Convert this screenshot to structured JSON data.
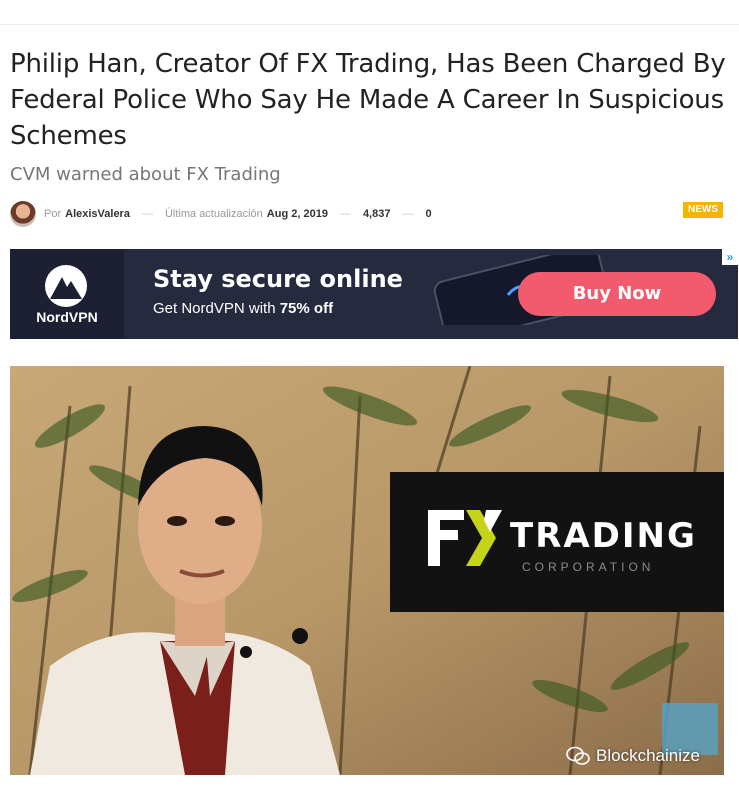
{
  "article": {
    "title": "Philip Han, Creator Of FX Trading, Has Been Charged By Federal Police Who Say He Made A Career In Suspicious Schemes",
    "subtitle": "CVM warned about FX Trading",
    "by_label": "Por",
    "author": "AlexisValera",
    "updated_label": "Última actualización",
    "date": "Aug 2, 2019",
    "views": "4,837",
    "comments": "0",
    "category_badge": "NEWS"
  },
  "ad": {
    "brand": "NordVPN",
    "headline": "Stay secure online",
    "sub_prefix": "Get NordVPN with ",
    "sub_bold": "75% off",
    "cta": "Buy Now",
    "adchoices_icon": "adchoices-icon",
    "colors": {
      "background": "#262a3f",
      "button": "#f25a6e"
    }
  },
  "hero": {
    "logo_word": "TRADING",
    "logo_sub": "CORPORATION",
    "logo_mark": "FX",
    "watermark": "Blockchainize",
    "watermark_icon": "wechat-icon"
  },
  "colors": {
    "badge": "#f5b400",
    "title": "#222222",
    "subtitle": "#777777"
  }
}
